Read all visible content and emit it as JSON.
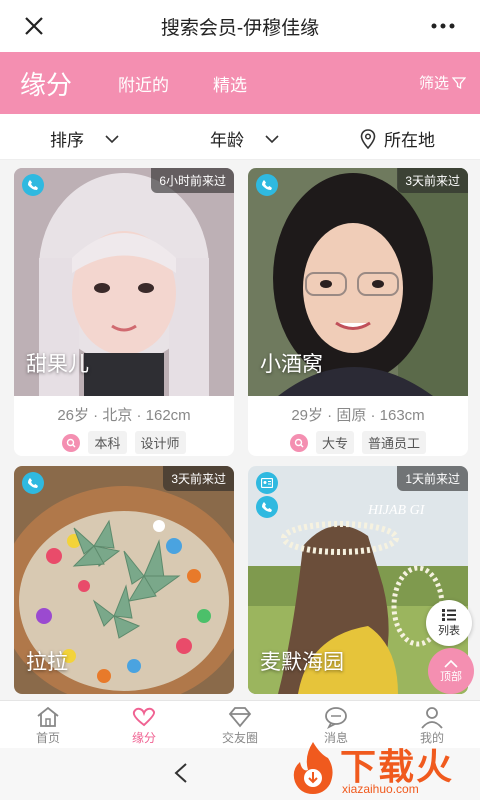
{
  "header": {
    "title": "搜索会员-伊穆佳缘"
  },
  "tabs": {
    "main": "缘分",
    "nearby": "附近的",
    "picks": "精选",
    "filter": "筛选"
  },
  "filters": {
    "sort": "排序",
    "age": "年龄",
    "location": "所在地"
  },
  "cards": [
    {
      "name": "甜果儿",
      "last_seen": "6小时前来过",
      "meta": "26岁 · 北京 · 162cm",
      "tags": [
        "本科",
        "设计师"
      ]
    },
    {
      "name": "小酒窝",
      "last_seen": "3天前来过",
      "meta": "29岁 · 固原 · 163cm",
      "tags": [
        "大专",
        "普通员工"
      ]
    },
    {
      "name": "拉拉",
      "last_seen": "3天前来过"
    },
    {
      "name": "麦默海园",
      "last_seen": "1天前来过",
      "photo_text": "HIJAB GI"
    }
  ],
  "floating": {
    "list_label": "列表",
    "top_label": "顶部"
  },
  "bottom_nav": [
    {
      "label": "首页",
      "icon": "home-icon"
    },
    {
      "label": "缘分",
      "icon": "heart-icon"
    },
    {
      "label": "交友圈",
      "icon": "diamond-icon"
    },
    {
      "label": "消息",
      "icon": "chat-icon"
    },
    {
      "label": "我的",
      "icon": "user-icon"
    }
  ],
  "watermark": {
    "brand": "下载火",
    "domain": "xiazaihuo.com"
  },
  "colors": {
    "accent": "#f48fb1",
    "nav_active": "#f06292",
    "badge": "#2fb9e0",
    "watermark": "#f05a1e"
  }
}
